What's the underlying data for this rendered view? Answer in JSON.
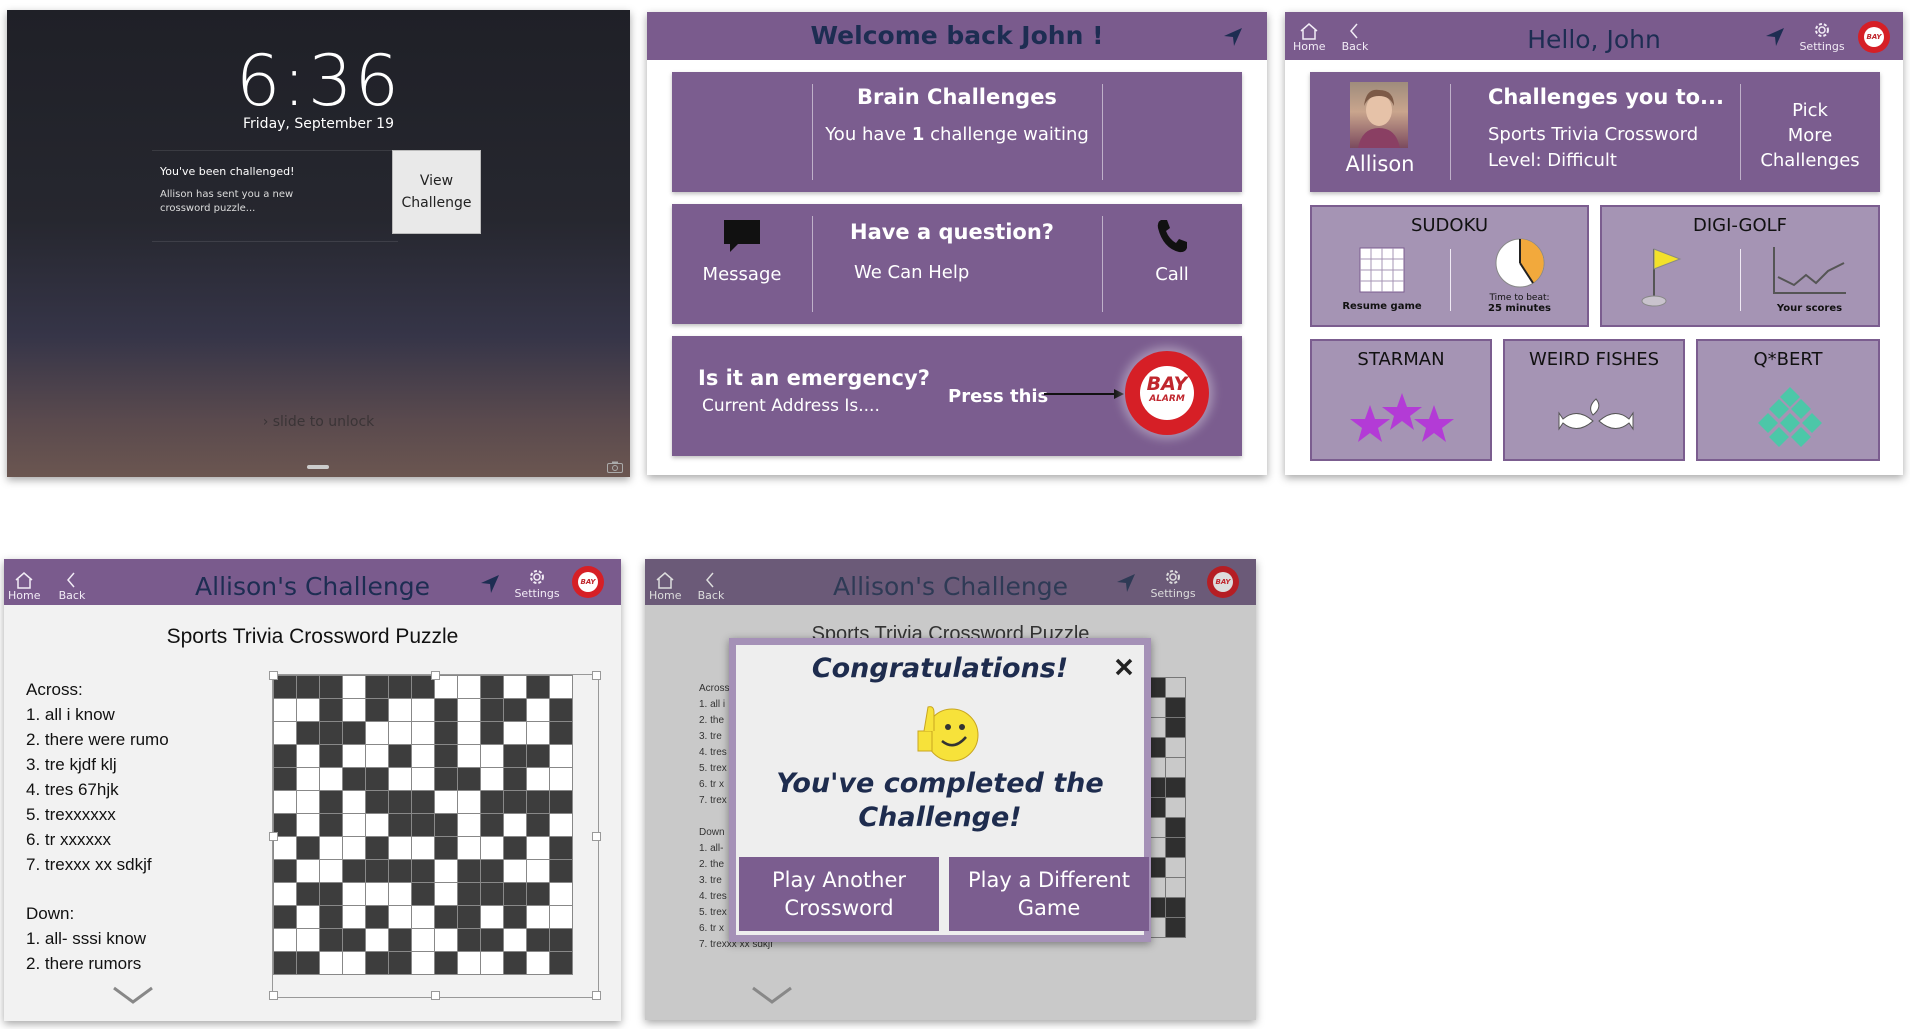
{
  "lockscreen": {
    "time": "6:36",
    "date": "Friday, September 19",
    "notif_title": "You've been challenged!",
    "notif_body": "Allison has sent you a new crossword puzzle...",
    "view_button": "View Challenge",
    "slide": "slide to unlock"
  },
  "home": {
    "title": "Welcome back John !",
    "brain": {
      "title": "Brain Challenges",
      "sub_pre": "You have ",
      "sub_count": "1",
      "sub_post": " challenge waiting"
    },
    "question": {
      "message": "Message",
      "title": "Have a question?",
      "sub": "We Can Help",
      "call": "Call"
    },
    "emergency": {
      "title": "Is it an emergency?",
      "sub": "Current Address Is....",
      "press": "Press this"
    },
    "bay_alarm": {
      "line1": "BAY",
      "line2": "ALARM"
    }
  },
  "nav": {
    "home": "Home",
    "back": "Back",
    "settings": "Settings"
  },
  "games": {
    "title": "Hello, John",
    "challenge_person": "Allison",
    "challenge_title": "Challenges you to...",
    "challenge_game": "Sports Trivia Crossword",
    "challenge_level": "Level: Difficult",
    "pick_more": [
      "Pick",
      "More",
      "Challenges"
    ],
    "sudoku": {
      "name": "SUDOKU",
      "resume": "Resume game",
      "time_label": "Time to beat:",
      "time_value": "25 minutes"
    },
    "digigolf": {
      "name": "DIGI-GOLF",
      "scores": "Your scores"
    },
    "starman": "STARMAN",
    "weird_fishes": "WEIRD FISHES",
    "qbert": "Q*BERT"
  },
  "crossword": {
    "title": "Allison's Challenge",
    "puzzle_title": "Sports Trivia Crossword Puzzle",
    "across_label": "Across:",
    "across": [
      "1. all i know",
      "2. there were rumo",
      "3. tre kjdf klj",
      "4. tres 67hjk",
      "5. trexxxxxx",
      "6. tr xxxxxx",
      "7. trexxx xx sdkjf"
    ],
    "down_label": "Down:",
    "down": [
      "1. all- sssi know",
      "2. there rumors"
    ]
  },
  "congrats": {
    "title": "Allison's Challenge",
    "puzzle_title": "Sports Trivia Crossword Puzzle",
    "heading": "Congratulations!",
    "message_line1": "You've completed the",
    "message_line2": "Challenge!",
    "btn_another": [
      "Play Another",
      "Crossword"
    ],
    "btn_different": [
      "Play a Different",
      "Game"
    ],
    "bg_across_label": "Across",
    "bg_across": [
      "1. all i",
      "2. the",
      "3. tre",
      "4. tres",
      "5. trex",
      "6. tr x",
      "7. trex"
    ],
    "bg_down_label": "Down",
    "bg_down": [
      "1. all-",
      "2. the",
      "3. tre",
      "4. tres",
      "5. trex",
      "6. tr x",
      "7. trexxx xx sdkjf"
    ]
  },
  "colors": {
    "header": "#7a5b8d",
    "card": "#7b5d8f",
    "tile": "#a594b4",
    "title_text": "#1d2d52"
  }
}
